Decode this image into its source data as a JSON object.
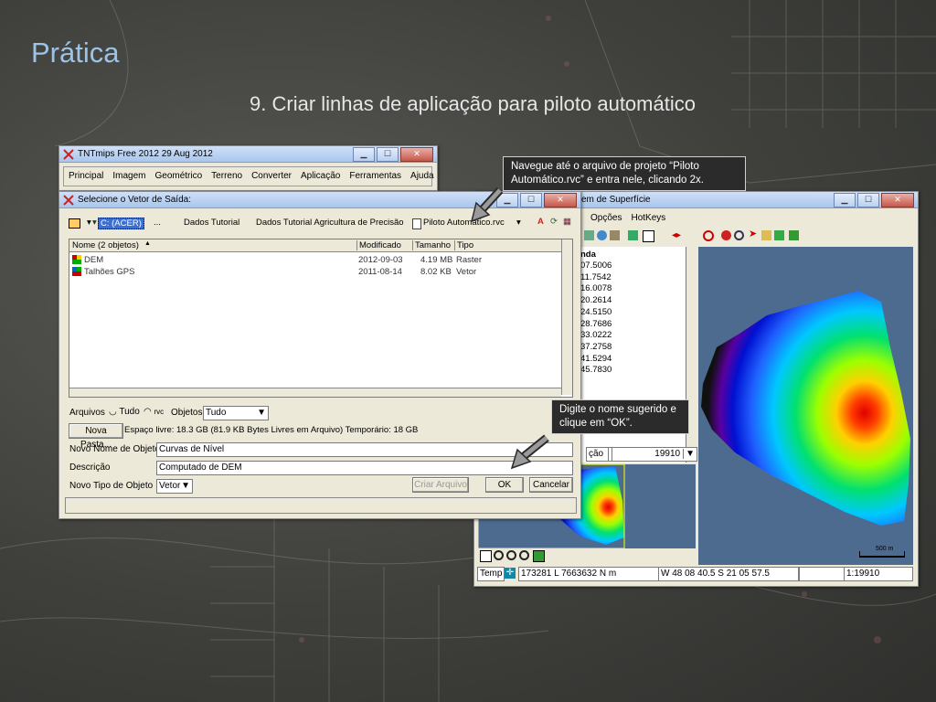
{
  "slide": {
    "title": "Prática",
    "subtitle": "9. Criar linhas de aplicação para piloto automático"
  },
  "main_window": {
    "title": "TNTmips Free 2012   29 Aug 2012",
    "menu": [
      "Principal",
      "Imagem",
      "Geométrico",
      "Terreno",
      "Converter",
      "Aplicação",
      "Ferramentas",
      "Ajuda"
    ]
  },
  "surface_window": {
    "title": "em de Superfície",
    "menu": [
      "Opções",
      "HotKeys"
    ],
    "legend_header": "nda",
    "legend_values": [
      "07.5006",
      "11.7542",
      "16.0078",
      "20.2614",
      "24.5150",
      "28.7686",
      "33.0222",
      "37.2758",
      "41.5294",
      "45.7830"
    ],
    "combo_left": "ção",
    "combo_right": "19910",
    "scale_label": "500 m",
    "status": {
      "temp_label": "Temp",
      "coords": "173281 L 7663632 N m",
      "geo": "W 48 08 40.5  S 21 05 57.5",
      "scale": "1:19910"
    }
  },
  "dialog": {
    "title": "Selecione o Vetor de Saída:",
    "path": [
      "C: (ACER)",
      "...",
      "Dados Tutorial",
      "Dados Tutorial Agricultura de Precisão",
      "Piloto Automático.rvc"
    ],
    "columns": [
      "Nome  (2 objetos)",
      "Modificado",
      "Tamanho",
      "Tipo"
    ],
    "files": [
      {
        "name": "DEM",
        "modified": "2012-09-03",
        "size": "4.19 MB",
        "type": "Raster"
      },
      {
        "name": "Talhões GPS",
        "modified": "2011-08-14",
        "size": "8.02 KB",
        "type": "Vetor"
      }
    ],
    "arquivos_label": "Arquivos",
    "tudo_label": "Tudo",
    "rvc_label": "rvc",
    "objetos_label": "Objetos",
    "objetos_value": "Tudo",
    "nova_pasta": "Nova Pasta...",
    "espaco": "Espaço livre: 18.3 GB  (81.9 KB Bytes Livres em Arquivo)    Temporário: 18 GB",
    "novo_nome_label": "Novo Nome de Objeto",
    "novo_nome_value": "Curvas de Nível",
    "descricao_label": "Descrição",
    "descricao_value": "Computado de DEM",
    "novo_tipo_label": "Novo Tipo de Objeto",
    "novo_tipo_value": "Vetor",
    "criar_arquivo": "Criar Arquivo",
    "ok": "OK",
    "cancelar": "Cancelar"
  },
  "callouts": {
    "navigate": "Navegue até o arquivo de projeto “Piloto Automático.rvc” e entra nele, clicando 2x.",
    "name": "Digite o nome sugerido e clique  em “OK”."
  }
}
